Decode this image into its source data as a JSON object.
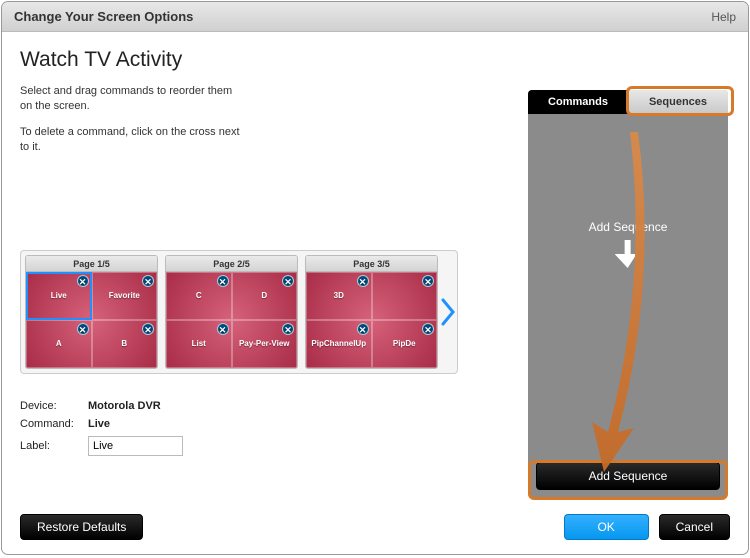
{
  "header": {
    "title": "Change Your Screen Options",
    "help": "Help"
  },
  "main": {
    "title": "Watch TV Activity",
    "instruction1": "Select and drag commands to reorder them on the screen.",
    "instruction2": "To delete a command, click on the cross next to it."
  },
  "pages": [
    {
      "label": "Page 1/5",
      "cells": [
        "Live",
        "Favorite",
        "A",
        "B"
      ]
    },
    {
      "label": "Page 2/5",
      "cells": [
        "C",
        "D",
        "List",
        "Pay-Per-View"
      ]
    },
    {
      "label": "Page 3/5",
      "cells": [
        "3D",
        "",
        "PipChannelUp",
        "PipDe"
      ]
    }
  ],
  "details": {
    "device_k": "Device:",
    "device_v": "Motorola DVR",
    "command_k": "Command:",
    "command_v": "Live",
    "label_k": "Label:",
    "label_v": "Live"
  },
  "side": {
    "tabs": [
      "Commands",
      "Sequences"
    ],
    "hint": "Add Sequence",
    "add_btn": "Add Sequence"
  },
  "footer": {
    "restore": "Restore Defaults",
    "ok": "OK",
    "cancel": "Cancel"
  },
  "colors": {
    "accent_blue": "#1e90ff",
    "highlight_orange": "#d67a2a",
    "card_bg": "#a82c47"
  }
}
